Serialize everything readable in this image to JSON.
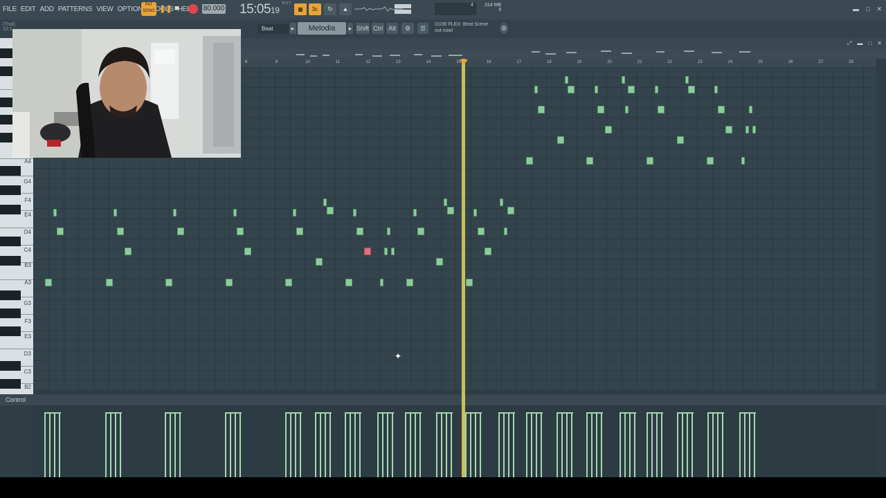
{
  "menu": [
    "FILE",
    "EDIT",
    "ADD",
    "PATTERNS",
    "VIEW",
    "OPTIONS",
    "TOOLS",
    "HELP"
  ],
  "transport": {
    "pat_label": "PAT SONG",
    "tempo": "80.000",
    "time": "15:05",
    "time_ticks": "19",
    "time_sub": "B:S:T",
    "cpu": "4",
    "memory": "314 MB",
    "memory_sub": "5"
  },
  "toolbar2": {
    "trial": "(Trial)",
    "trial_sub": "12:1",
    "pattern_target": "Beat",
    "channel": "Melodia",
    "keys": [
      "Shift",
      "Ctrl",
      "Alt"
    ],
    "hint_line1": "01/30  FLEX: Beat Scene",
    "hint_line2": "out now!"
  },
  "piano_roll": {
    "ruler": [
      "8",
      "9",
      "10",
      "11",
      "12",
      "13",
      "14",
      "15",
      "16",
      "17",
      "18",
      "19",
      "20",
      "21",
      "22",
      "23",
      "24",
      "25",
      "26",
      "27",
      "28"
    ],
    "key_labels": [
      "A4",
      "G4",
      "F4",
      "E4",
      "D4",
      "C4",
      "B3",
      "A3",
      "G3",
      "F3",
      "E3",
      "D3",
      "C3",
      "B2"
    ],
    "control_label": "Control"
  },
  "colors": {
    "note": "#8ccc9c",
    "note_selected": "#e0707e",
    "playhead": "#e3d75c",
    "accent": "#e9a33c"
  },
  "icons": [
    "play-icon",
    "stop-icon",
    "record-icon",
    "waveform-icon",
    "minimize-icon",
    "maximize-icon",
    "close-icon",
    "pointer-cursor-icon"
  ]
}
